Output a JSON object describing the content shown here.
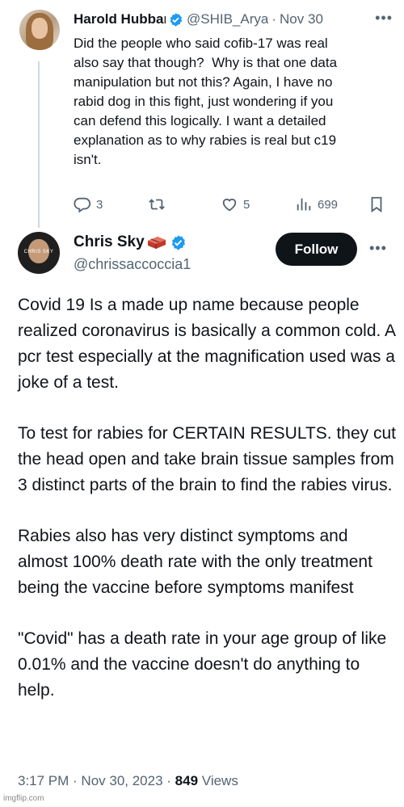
{
  "reply_tweet": {
    "author_name": "Harold Hubbar",
    "handle": "@SHIB_Arya",
    "dot": "·",
    "date": "Nov 30",
    "body": "Did the people who said cofib-17 was real\nalso say that though?  Why is that one data\nmanipulation but not this? Again, I have no\nrabid dog in this fight, just wondering if you\ncan defend this logically. I want a detailed\nexplanation as to why rabies is real but c19\nisn't.",
    "actions": {
      "replies": "3",
      "retweets": "",
      "likes": "5",
      "views": "699"
    }
  },
  "main_tweet": {
    "author_name": "Chris Sky",
    "handle": "@chrissaccoccia1",
    "avatar_text": "CHRIS SKY",
    "follow_label": "Follow",
    "paragraphs": [
      "Covid 19 Is a made up name because people realized coronavirus is basically a common cold. A pcr test especially at the magnification used was a joke of a test.",
      "To test for rabies for CERTAIN RESULTS. they cut the head open and take brain tissue samples from 3 distinct parts of the brain to find the rabies virus.",
      "Rabies also has very distinct symptoms and almost 100% death rate with the only treatment being the vaccine before symptoms manifest",
      "\"Covid\" has a death rate in your age group of like 0.01% and the vaccine doesn't do anything to help."
    ],
    "timestamp": "3:17 PM · Nov 30, 2023",
    "view_count": "849",
    "views_label": "Views"
  },
  "watermark": "imgflip.com",
  "icons": {
    "reply": "reply-icon",
    "retweet": "retweet-icon",
    "like": "heart-icon",
    "views": "views-chart-icon",
    "bookmark": "bookmark-icon",
    "verified": "verified-badge-icon",
    "brick": "brick-emoji-icon",
    "more": "more-options-icon"
  },
  "colors": {
    "verified": "#1d9bf0",
    "secondary_text": "#536471",
    "follow_button": "#0f1419",
    "brick": "#c0392b"
  }
}
